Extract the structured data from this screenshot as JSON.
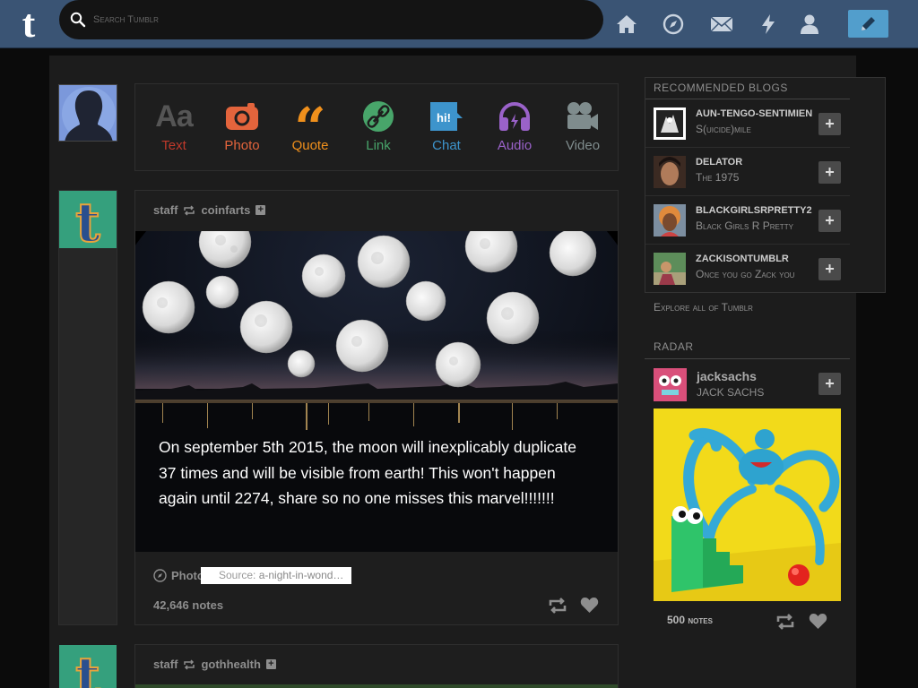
{
  "header": {
    "search_placeholder": "Search Tumblr",
    "nav_icons": [
      "home-icon",
      "compass-icon",
      "mail-icon",
      "lightning-icon",
      "person-icon"
    ],
    "compose_icon": "pencil-icon",
    "colors": {
      "bar": "#3a5474",
      "compose": "#529ecc"
    }
  },
  "post_types": [
    {
      "label": "Text",
      "icon": "text-aa-icon",
      "color": "#c0392b"
    },
    {
      "label": "Photo",
      "icon": "camera-icon",
      "color": "#e3643c"
    },
    {
      "label": "Quote",
      "icon": "quote-icon",
      "color": "#f0901c"
    },
    {
      "label": "Link",
      "icon": "link-icon",
      "color": "#48a56a"
    },
    {
      "label": "Chat",
      "icon": "chat-icon",
      "color": "#3d94cc"
    },
    {
      "label": "Audio",
      "icon": "headphones-icon",
      "color": "#9a62c9"
    },
    {
      "label": "Video",
      "icon": "video-camera-icon",
      "color": "#7f8c8d"
    }
  ],
  "chat_icon_text": "hi!",
  "posts": [
    {
      "author": "staff",
      "reblogged_from": "coinfarts",
      "image_text": "On september 5th 2015, the moon will inexplicably duplicate 37 times and will be visible from earth! This won't happen again until 2274, share so no one misses this marvel!!!!!!!",
      "type_label": "Photos",
      "source_label": "Source:",
      "source_value": "a-night-in-wond…",
      "notes": "42,646 notes"
    },
    {
      "author": "staff",
      "reblogged_from": "gothhealth"
    }
  ],
  "recommended": {
    "title": "RECOMMENDED BLOGS",
    "items": [
      {
        "name": "AUN-TENGO-SENTIMIEN",
        "title": "S(uicide)mile"
      },
      {
        "name": "DELATOR",
        "title": "The 1975"
      },
      {
        "name": "BLACKGIRLSRPRETTY2",
        "title": "Black Girls R Pretty"
      },
      {
        "name": "ZACKISONTUMBLR",
        "title": "Once you go Zack you"
      }
    ],
    "explore": "Explore all of Tumblr"
  },
  "radar": {
    "title": "RADAR",
    "blog_name": "jacksachs",
    "blog_title": "JACK SACHS",
    "notes": "500 notes"
  }
}
